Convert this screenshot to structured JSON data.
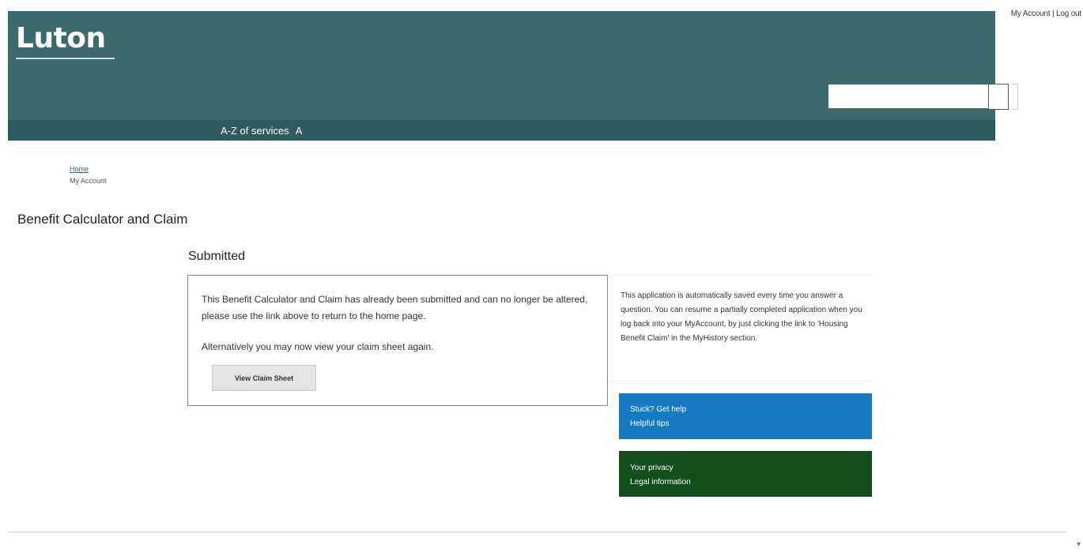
{
  "top_links": {
    "account": "My Account",
    "separator": " | ",
    "logout": "Log out"
  },
  "header": {
    "logo": "Luton",
    "search_placeholder": ""
  },
  "nav": {
    "items": [
      "A-Z of services",
      "A"
    ]
  },
  "breadcrumb": {
    "home": "Home",
    "current": "My Account"
  },
  "page": {
    "title": "Benefit Calculator and Claim",
    "section_title": "Submitted"
  },
  "notice": {
    "message": "This Benefit Calculator and Claim has already been submitted and can no longer be altered, please use the link above to return to the home page.",
    "alternative": "Alternatively you may now view your claim sheet again.",
    "button_label": "View Claim Sheet"
  },
  "sidebar": {
    "info": "This application is automatically saved every time you answer a question. You can resume a partially completed application when you log back into your MyAccount, by just clicking the link to 'Housing Benefit Claim' in the MyHistory section.",
    "help_links": [
      "Stuck? Get help",
      "Helpful tips"
    ],
    "privacy_links": [
      "Your privacy",
      "Legal information"
    ]
  },
  "colors": {
    "header": "#3c6a6d",
    "nav": "#2f5b5e",
    "help": "#157ac2",
    "privacy": "#114f1c"
  }
}
